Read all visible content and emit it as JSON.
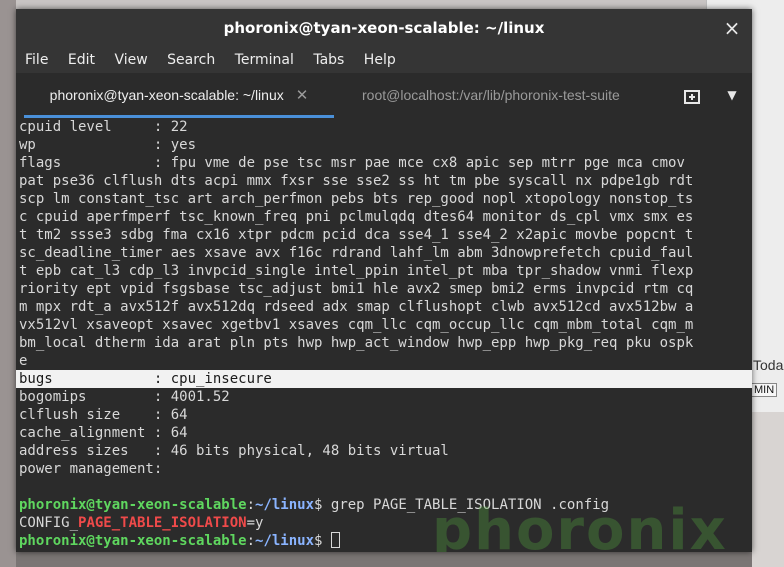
{
  "window": {
    "title": "phoronix@tyan-xeon-scalable: ~/linux"
  },
  "menu": [
    "File",
    "Edit",
    "View",
    "Search",
    "Terminal",
    "Tabs",
    "Help"
  ],
  "tabs": [
    {
      "label": "phoronix@tyan-xeon-scalable: ~/linux",
      "active": true
    },
    {
      "label": "root@localhost:/var/lib/phoronix-test-suite",
      "active": false
    }
  ],
  "terminal": {
    "cpuinfo_lines": [
      "cpuid level     : 22",
      "wp              : yes",
      "flags           : fpu vme de pse tsc msr pae mce cx8 apic sep mtrr pge mca cmov",
      "pat pse36 clflush dts acpi mmx fxsr sse sse2 ss ht tm pbe syscall nx pdpe1gb rdt",
      "scp lm constant_tsc art arch_perfmon pebs bts rep_good nopl xtopology nonstop_ts",
      "c cpuid aperfmperf tsc_known_freq pni pclmulqdq dtes64 monitor ds_cpl vmx smx es",
      "t tm2 ssse3 sdbg fma cx16 xtpr pdcm pcid dca sse4_1 sse4_2 x2apic movbe popcnt t",
      "sc_deadline_timer aes xsave avx f16c rdrand lahf_lm abm 3dnowprefetch cpuid_faul",
      "t epb cat_l3 cdp_l3 invpcid_single intel_ppin intel_pt mba tpr_shadow vnmi flexp",
      "riority ept vpid fsgsbase tsc_adjust bmi1 hle avx2 smep bmi2 erms invpcid rtm cq",
      "m mpx rdt_a avx512f avx512dq rdseed adx smap clflushopt clwb avx512cd avx512bw a",
      "vx512vl xsaveopt xsavec xgetbv1 xsaves cqm_llc cqm_occup_llc cqm_mbm_total cqm_m",
      "bm_local dtherm ida arat pln pts hwp hwp_act_window hwp_epp hwp_pkg_req pku ospk",
      "e"
    ],
    "bugs_line": "bugs            : cpu_insecure",
    "tail_lines": [
      "bogomips        : 4001.52",
      "clflush size    : 64",
      "cache_alignment : 64",
      "address sizes   : 46 bits physical, 48 bits virtual",
      "power management:"
    ],
    "prompt_user": "phoronix@tyan-xeon-scalable",
    "prompt_path": "~/linux",
    "command": "grep PAGE_TABLE_ISOLATION .config",
    "output_prefix": "CONFIG_",
    "output_match": "PAGE_TABLE_ISOLATION",
    "output_suffix": "=y"
  },
  "watermark": "phoronix",
  "background": {
    "text": "Toda",
    "badge": "MIN"
  },
  "colors": {
    "prompt_user": "#5fd75f",
    "prompt_path": "#8ab4ff",
    "match": "#ef4a4a",
    "tab_indicator": "#4a90d9"
  }
}
